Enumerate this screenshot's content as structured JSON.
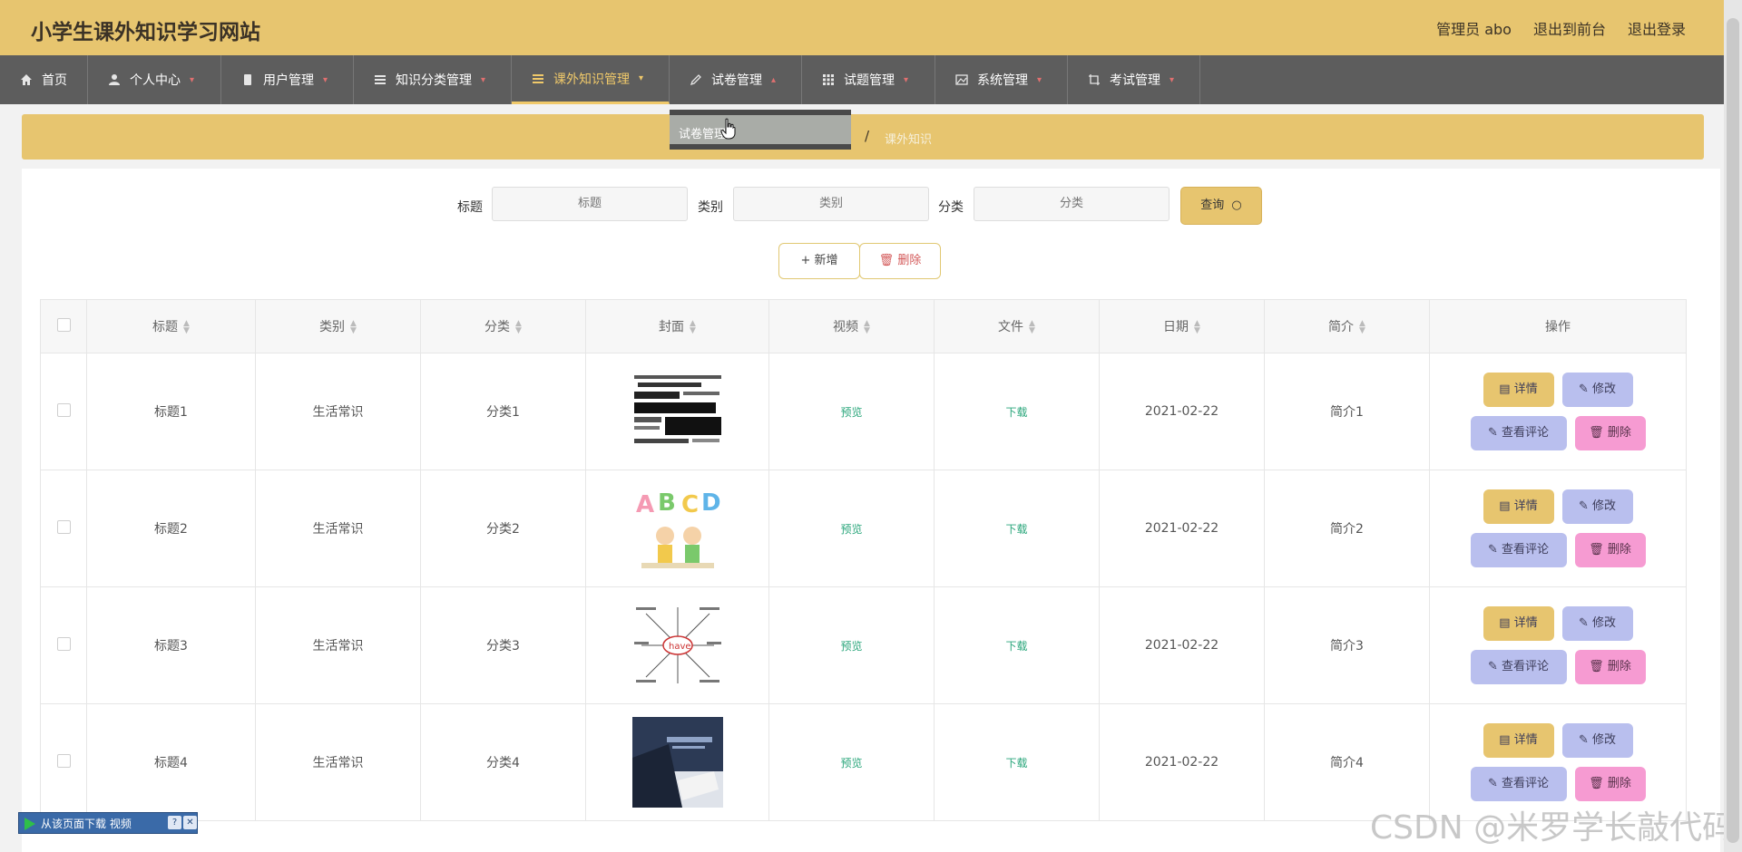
{
  "header": {
    "title": "小学生课外知识学习网站",
    "links": [
      "管理员 abo",
      "退出到前台",
      "退出登录"
    ]
  },
  "nav": {
    "items": [
      "首页",
      "个人中心",
      "用户管理",
      "知识分类管理",
      "课外知识管理",
      "试卷管理",
      "试题管理",
      "系统管理",
      "考试管理"
    ],
    "active": "课外知识管理",
    "dropdown_item": "试卷管理"
  },
  "breadcrumb": {
    "sep": "/",
    "current": "课外知识"
  },
  "search": {
    "labels": [
      "标题",
      "类别",
      "分类"
    ],
    "placeholders": [
      "标题",
      "类别",
      "分类"
    ],
    "query_label": "查询"
  },
  "actions": {
    "add_label": "新增",
    "delete_label": "删除"
  },
  "table": {
    "headers": [
      "标题",
      "类别",
      "分类",
      "封面",
      "视频",
      "文件",
      "日期",
      "简介",
      "操作"
    ],
    "rows": [
      {
        "title": "标题1",
        "type": "生活常识",
        "cat": "分类1",
        "video": "预览",
        "file": "下载",
        "date": "2021-02-22",
        "intro": "简介1"
      },
      {
        "title": "标题2",
        "type": "生活常识",
        "cat": "分类2",
        "video": "预览",
        "file": "下载",
        "date": "2021-02-22",
        "intro": "简介2"
      },
      {
        "title": "标题3",
        "type": "生活常识",
        "cat": "分类3",
        "video": "预览",
        "file": "下载",
        "date": "2021-02-22",
        "intro": "简介3"
      },
      {
        "title": "标题4",
        "type": "生活常识",
        "cat": "分类4",
        "video": "预览",
        "file": "下载",
        "date": "2021-02-22",
        "intro": "简介4"
      }
    ],
    "ops": {
      "detail": "详情",
      "edit": "修改",
      "comment": "查看评论",
      "remove": "删除"
    }
  },
  "overlay": {
    "video_bar": "从该页面下载 视频",
    "watermark": "CSDN @米罗学长敲代码"
  },
  "colors": {
    "brand": "#e7c56f",
    "nav": "#5d5d5d",
    "link": "#2aa67b"
  }
}
